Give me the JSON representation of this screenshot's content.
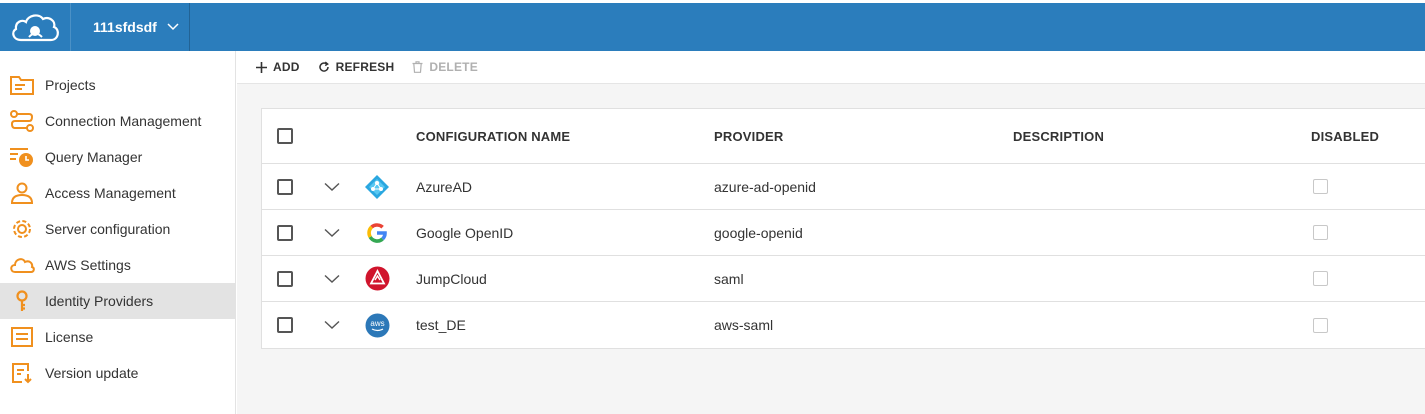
{
  "header": {
    "project_name": "111sfdsdf"
  },
  "sidebar": {
    "items": [
      {
        "label": "Projects",
        "icon": "projects-icon"
      },
      {
        "label": "Connection Management",
        "icon": "connection-icon"
      },
      {
        "label": "Query Manager",
        "icon": "query-manager-icon"
      },
      {
        "label": "Access Management",
        "icon": "user-icon"
      },
      {
        "label": "Server configuration",
        "icon": "gear-icon"
      },
      {
        "label": "AWS Settings",
        "icon": "cloud-icon"
      },
      {
        "label": "Identity Providers",
        "icon": "key-icon"
      },
      {
        "label": "License",
        "icon": "license-icon"
      },
      {
        "label": "Version update",
        "icon": "version-update-icon"
      }
    ],
    "active_item": "Identity Providers",
    "icon_color": "#f0901e"
  },
  "toolbar": {
    "add_label": "ADD",
    "refresh_label": "REFRESH",
    "delete_label": "DELETE"
  },
  "table": {
    "headers": {
      "name": "CONFIGURATION NAME",
      "provider": "PROVIDER",
      "description": "DESCRIPTION",
      "disabled": "DISABLED"
    },
    "rows": [
      {
        "name": "AzureAD",
        "provider": "azure-ad-openid",
        "description": "",
        "icon": "azure-ad-icon"
      },
      {
        "name": "Google OpenID",
        "provider": "google-openid",
        "description": "",
        "icon": "google-icon"
      },
      {
        "name": "JumpCloud",
        "provider": "saml",
        "description": "",
        "icon": "jumpcloud-icon"
      },
      {
        "name": "test_DE",
        "provider": "aws-saml",
        "description": "",
        "icon": "aws-icon"
      }
    ]
  },
  "colors": {
    "header_bg": "#2b7dbc",
    "accent": "#f0901e"
  }
}
